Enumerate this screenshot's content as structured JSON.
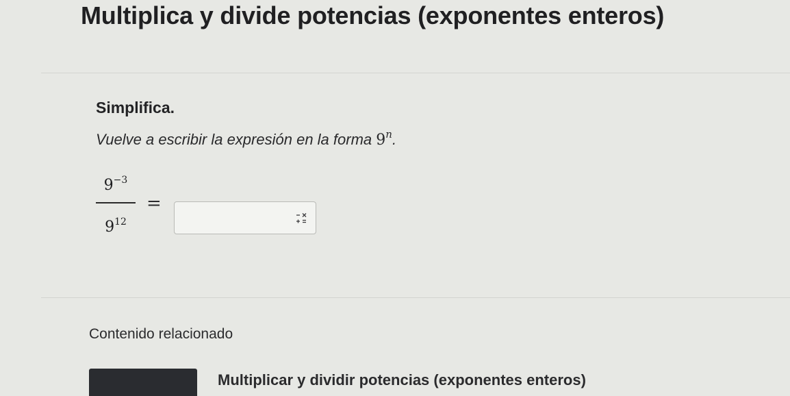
{
  "header": {
    "title": "Multiplica y divide potencias (exponentes enteros)"
  },
  "problem": {
    "instruction": "Simplifica.",
    "subinstruction": "Vuelve a escribir la expresión en la forma",
    "form_base": "9",
    "form_exponent": "n",
    "form_period": ".",
    "fraction": {
      "numerator_base": "9",
      "numerator_exponent": "−3",
      "denominator_base": "9",
      "denominator_exponent": "12"
    },
    "equals": "=",
    "answer": {
      "value": "",
      "placeholder": ""
    },
    "keypad_icon": "math-keypad-icon"
  },
  "related": {
    "heading": "Contenido relacionado",
    "link_label": "Multiplicar y dividir potencias (exponentes enteros)"
  },
  "colors": {
    "background": "#e7e8e4",
    "text": "#1f1f20",
    "thumbnail": "#2a2c30",
    "input_border": "#b9bab6"
  }
}
